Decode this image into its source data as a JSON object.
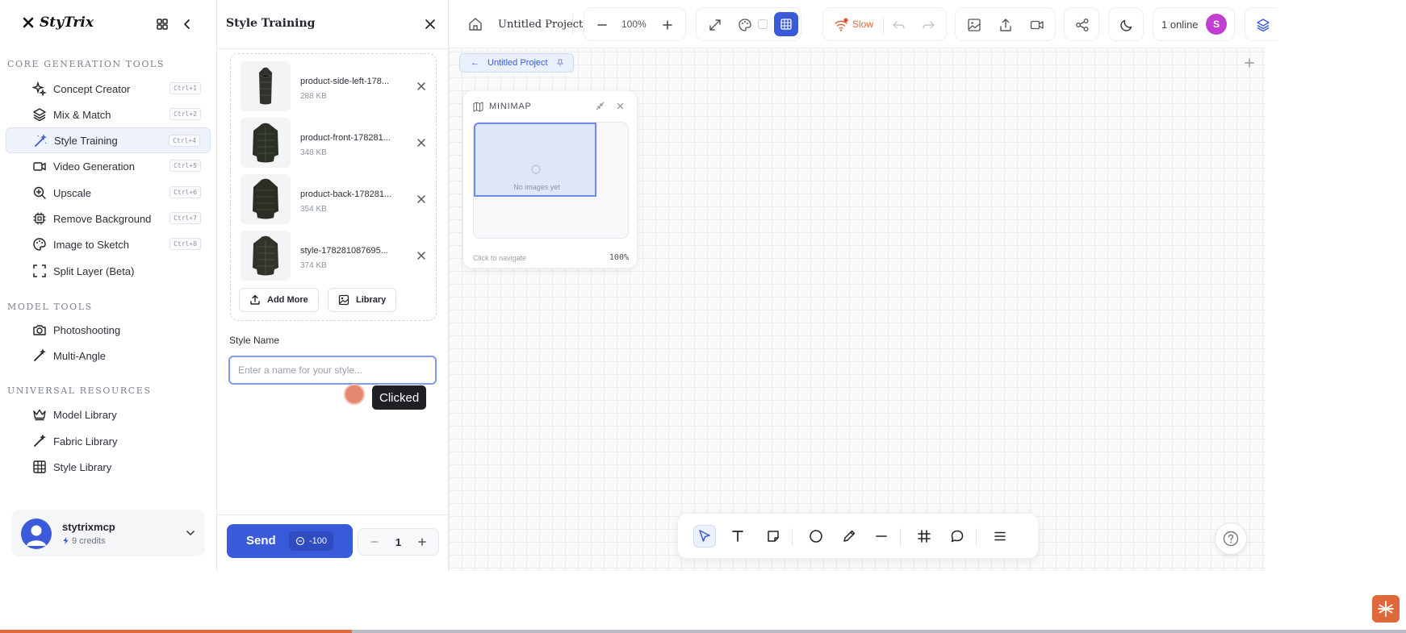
{
  "brand": {
    "name": "StyTrix"
  },
  "sidebar": {
    "sections": [
      {
        "label": "CORE GENERATION TOOLS"
      },
      {
        "label": "MODEL TOOLS"
      },
      {
        "label": "UNIVERSAL RESOURCES"
      }
    ],
    "core_items": [
      {
        "label": "Concept Creator",
        "shortcut": "Ctrl+1",
        "icon": "sparkles-icon"
      },
      {
        "label": "Mix & Match",
        "shortcut": "Ctrl+2",
        "icon": "layers-icon"
      },
      {
        "label": "Style Training",
        "shortcut": "Ctrl+4",
        "icon": "magic-wand-icon",
        "active": true
      },
      {
        "label": "Video Generation",
        "shortcut": "Ctrl+5",
        "icon": "video-icon"
      },
      {
        "label": "Upscale",
        "shortcut": "Ctrl+6",
        "icon": "zoom-in-icon"
      },
      {
        "label": "Remove Background",
        "shortcut": "Ctrl+7",
        "icon": "chip-icon"
      },
      {
        "label": "Image to Sketch",
        "shortcut": "Ctrl+8",
        "icon": "palette-icon"
      },
      {
        "label": "Split Layer (Beta)",
        "shortcut": "",
        "icon": "frame-icon"
      }
    ],
    "model_items": [
      {
        "label": "Photoshooting",
        "icon": "camera-icon"
      },
      {
        "label": "Multi-Angle",
        "icon": "magic-wand-icon"
      }
    ],
    "resource_items": [
      {
        "label": "Model Library",
        "icon": "crown-icon"
      },
      {
        "label": "Fabric Library",
        "icon": "magic-wand-icon"
      },
      {
        "label": "Style Library",
        "icon": "grid-icon"
      }
    ],
    "user": {
      "name": "stytrixmcp",
      "credits": "9 credits"
    }
  },
  "panel": {
    "title": "Style Training",
    "files": [
      {
        "name": "product-side-left-178...",
        "size": "288 KB"
      },
      {
        "name": "product-front-178281...",
        "size": "348 KB"
      },
      {
        "name": "product-back-178281...",
        "size": "354 KB"
      },
      {
        "name": "style-178281087695...",
        "size": "374 KB"
      }
    ],
    "add_more_label": "Add More",
    "library_label": "Library",
    "style_name_label": "Style Name",
    "style_name_placeholder": "Enter a name for your style...",
    "style_name_value": "",
    "tooltip": "Clicked",
    "send_label": "Send",
    "send_cost": "-100",
    "quantity": "1"
  },
  "topbar": {
    "project_name": "Untitled Project",
    "zoom": "100%",
    "speed_label": "Slow",
    "online_label": "1 online",
    "avatar_initial": "S"
  },
  "canvas": {
    "project_chip": "Untitled Project",
    "minimap": {
      "title": "MINIMAP",
      "empty_text": "No images yet",
      "footer_hint": "Click to navigate",
      "zoom": "100%"
    }
  },
  "page_progress": 0.25,
  "colors": {
    "accent": "#3a5bd9",
    "active_bg": "#eef2fb",
    "progress": "#e06a3c",
    "avatar": "#c13fd0"
  }
}
